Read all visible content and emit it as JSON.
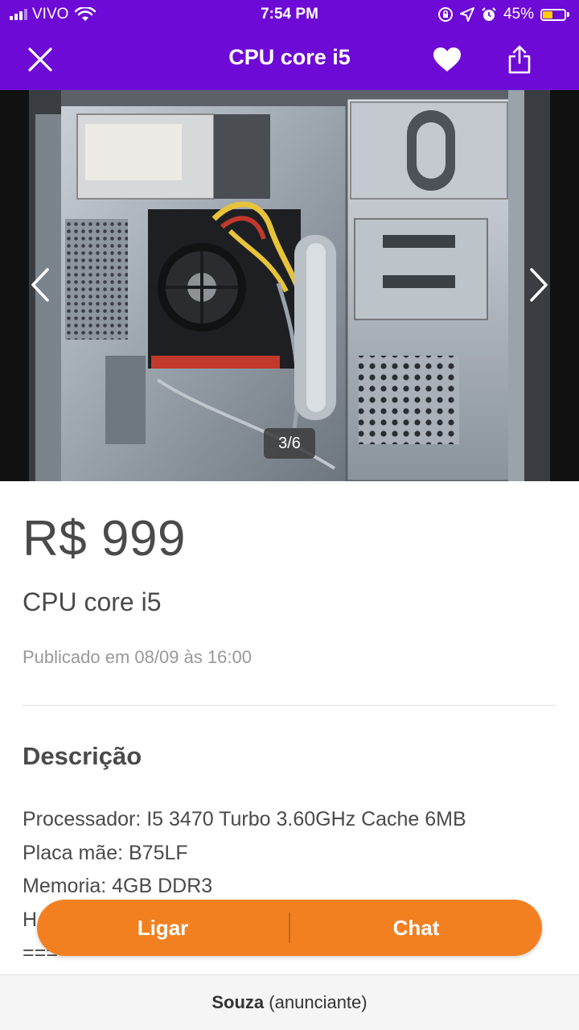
{
  "status_bar": {
    "carrier": "VIVO",
    "time": "7:54 PM",
    "battery": "45%",
    "battery_level": 0.45
  },
  "nav": {
    "title": "CPU core i5",
    "icons": {
      "close": "close-icon",
      "favorite": "heart-icon",
      "share": "share-icon"
    }
  },
  "gallery": {
    "counter": "3/6",
    "current": 3,
    "total": 6,
    "image_alt": "computer case interior photo"
  },
  "listing": {
    "price": "R$ 999",
    "title": "CPU core i5",
    "published": "Publicado em 08/09 às 16:00"
  },
  "description": {
    "heading": "Descrição",
    "lines": [
      "Processador: I5 3470 Turbo 3.60GHz Cache 6MB",
      "Placa mãe: B75LF",
      "Memoria: 4GB DDR3",
      "H",
      "==="
    ]
  },
  "actions": {
    "call_label": "Ligar",
    "chat_label": "Chat"
  },
  "footer": {
    "seller_name": "Souza",
    "seller_role": "(anunciante)"
  },
  "colors": {
    "brand_purple": "#6e0ad6",
    "action_orange": "#f28021"
  }
}
